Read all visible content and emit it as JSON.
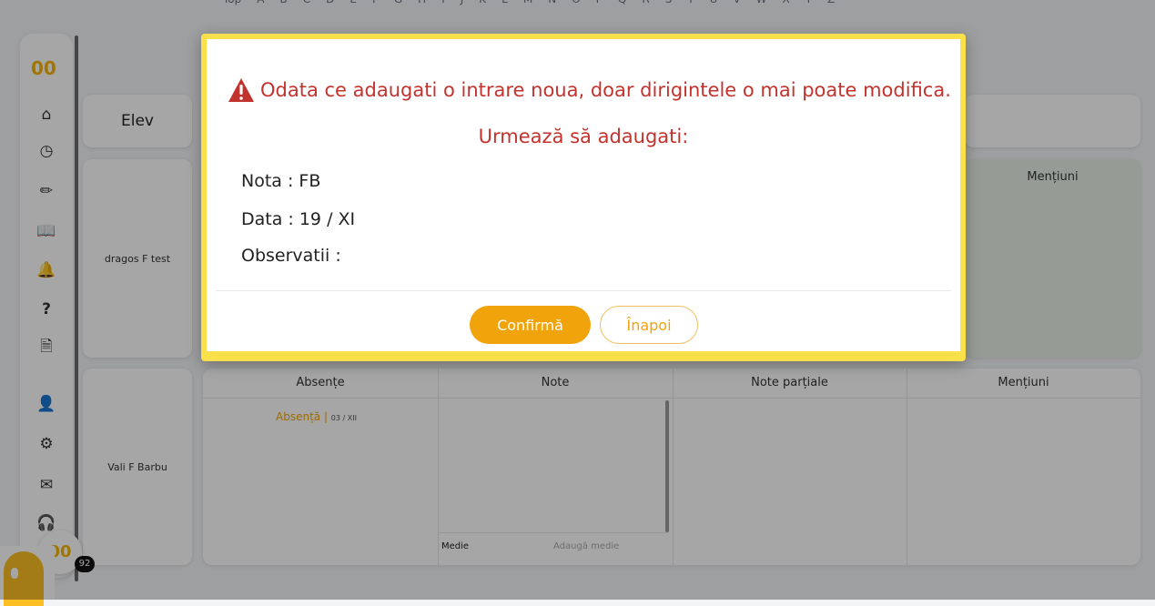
{
  "alphabet": [
    "Top",
    "A",
    "B",
    "C",
    "D",
    "E",
    "F",
    "G",
    "H",
    "I",
    "J",
    "K",
    "L",
    "M",
    "N",
    "O",
    "P",
    "Q",
    "R",
    "S",
    "T",
    "U",
    "V",
    "W",
    "X",
    "Y",
    "Z"
  ],
  "logo": "00",
  "sidebar": {
    "icons": [
      "home-icon",
      "clock-icon",
      "pencil-icon",
      "book-icon",
      "bell-icon",
      "question-icon",
      "document-icon",
      "contact-card-icon",
      "settings-gears-icon",
      "envelope-icon",
      "headset-icon"
    ]
  },
  "table": {
    "elev_label": "Elev",
    "students": [
      "dragos F test",
      "Vali F Barbu"
    ],
    "mentiuni_label": "Mențiuni",
    "columns": [
      "Absențe",
      "Note",
      "Note parțiale",
      "Mențiuni"
    ],
    "absence": {
      "label": "Absență",
      "date": "03 / XII"
    },
    "medie_label": "Medie",
    "medie_placeholder": "Adaugă medie"
  },
  "modal": {
    "warning": "Odata ce adaugati o intrare noua, doar dirigintele o mai poate modifica.",
    "subtitle": "Urmează să adaugati:",
    "nota": "Nota : FB",
    "data": "Data : 19 / XI",
    "observatii": "Observatii :",
    "confirm_label": "Confirmă",
    "back_label": "Înapoi"
  },
  "chat": {
    "logo": "00",
    "badge": "92"
  },
  "colors": {
    "accent": "#f0a30a",
    "warning_red": "#c2332e",
    "modal_border": "#fae04a",
    "mentiuni_bg": "#e5f0e5"
  }
}
